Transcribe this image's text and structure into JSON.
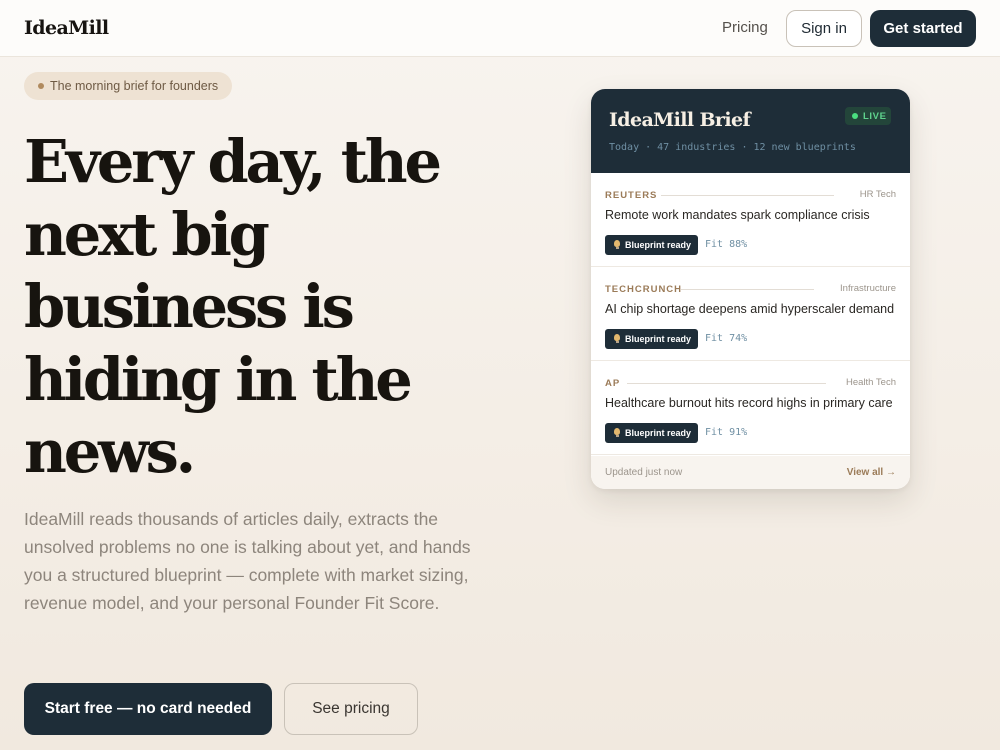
{
  "nav": {
    "logo": "IdeaMill",
    "pricing_label": "Pricing",
    "signin_label": "Sign in",
    "getstarted_label": "Get started"
  },
  "hero": {
    "pill": "The morning brief for founders",
    "headline_lines": [
      "Every day, the",
      "next big",
      "business is",
      "hiding in the",
      "news."
    ],
    "subcopy": "IdeaMill reads thousands of articles daily, extracts the unsolved problems no one is talking about yet, and hands you a structured blueprint — complete with market sizing, revenue model, and your personal Founder Fit Score.",
    "primary_cta": "Start free — no card needed",
    "secondary_cta": "See pricing"
  },
  "brief": {
    "title": "IdeaMill Brief",
    "live": "LIVE",
    "meta": "Today · 47 industries · 12 new blueprints",
    "items": [
      {
        "source": "REUTERS",
        "category": "HR Tech",
        "headline": "Remote work mandates spark compliance crisis",
        "badge": "Blueprint ready",
        "fit": "Fit 88%"
      },
      {
        "source": "TECHCRUNCH",
        "category": "Infrastructure",
        "headline": "AI chip shortage deepens amid hyperscaler demand",
        "badge": "Blueprint ready",
        "fit": "Fit 74%"
      },
      {
        "source": "AP",
        "category": "Health Tech",
        "headline": "Healthcare burnout hits record highs in primary care",
        "badge": "Blueprint ready",
        "fit": "Fit 91%"
      }
    ],
    "updated": "Updated just now",
    "view_all": "View all →"
  },
  "colors": {
    "accent_dark": "#1e2d38",
    "accent_brown": "#9b7b58",
    "live_green": "#4ade80"
  }
}
